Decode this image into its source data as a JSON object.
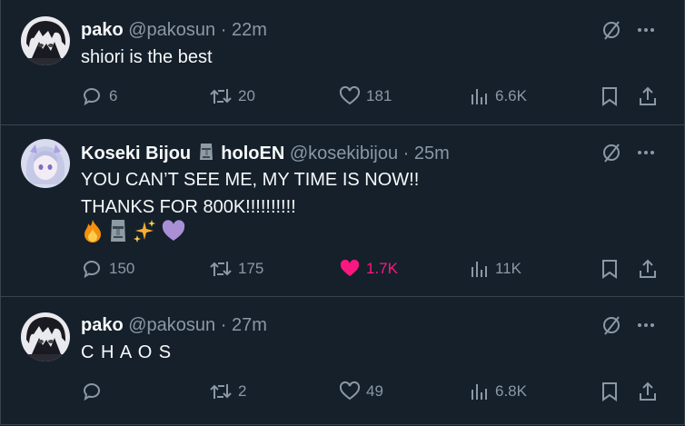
{
  "tweets": [
    {
      "name": "pako",
      "handle": "@pakosun",
      "sep": "·",
      "time": "22m",
      "text": "shiori is the best",
      "replies": "6",
      "reposts": "20",
      "likes": "181",
      "views": "6.6K",
      "liked": false
    },
    {
      "name": "Koseki Bijou",
      "name_suffix": "holoEN",
      "handle": "@kosekibijou",
      "sep": "·",
      "time": "25m",
      "text": "YOU CAN’T SEE ME, MY TIME IS NOW!!\nTHANKS FOR 800K!!!!!!!!!!",
      "emojis": [
        "fire-emoji",
        "moai-emoji",
        "sparkles-emoji",
        "purple-heart-emoji"
      ],
      "replies": "150",
      "reposts": "175",
      "likes": "1.7K",
      "views": "11K",
      "liked": true
    },
    {
      "name": "pako",
      "handle": "@pakosun",
      "sep": "·",
      "time": "27m",
      "text": "C H A O S",
      "replies": "",
      "reposts": "2",
      "likes": "49",
      "views": "6.8K",
      "liked": false
    }
  ],
  "colors": {
    "background": "#15202b",
    "text": "#f7f9f9",
    "muted": "#8b98a5",
    "border": "#38444d",
    "like_active": "#f91880"
  }
}
